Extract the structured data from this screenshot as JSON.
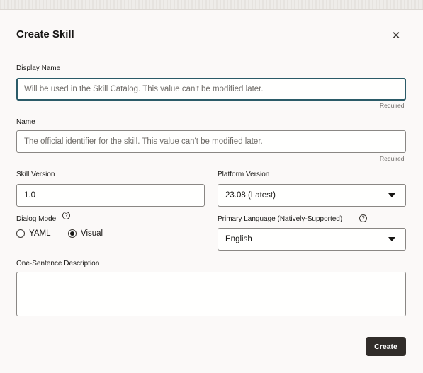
{
  "dialog": {
    "title": "Create Skill",
    "close_icon": "close-icon"
  },
  "display_name": {
    "label": "Display Name",
    "placeholder": "Will be used in the Skill Catalog. This value can't be modified later.",
    "hint": "Required"
  },
  "name": {
    "label": "Name",
    "placeholder": "The official identifier for the skill. This value can't be modified later.",
    "hint": "Required"
  },
  "skill_version": {
    "label": "Skill Version",
    "value": "1.0"
  },
  "platform_version": {
    "label": "Platform Version",
    "value": "23.08 (Latest)"
  },
  "dialog_mode": {
    "label": "Dialog Mode",
    "options": [
      "YAML",
      "Visual"
    ],
    "selected": "Visual"
  },
  "primary_language": {
    "label": "Primary Language (Natively-Supported)",
    "value": "English"
  },
  "description": {
    "label": "One-Sentence Description",
    "value": ""
  },
  "actions": {
    "create_label": "Create"
  },
  "colors": {
    "primary_button": "#312d2a",
    "focus_border": "#2b5b68",
    "background": "#fbf9f8"
  }
}
